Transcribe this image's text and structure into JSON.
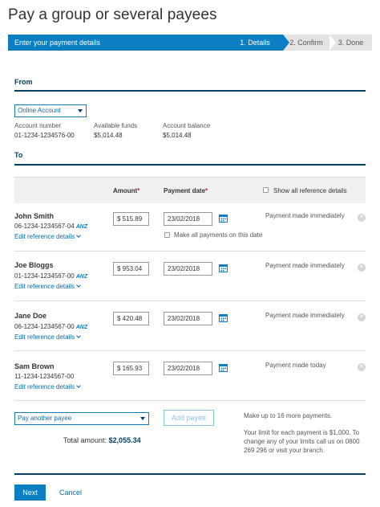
{
  "title": "Pay a group or several payees",
  "progress": {
    "main": "Enter your payment details",
    "steps": [
      "1. Details",
      "2. Confirm",
      "3. Done"
    ]
  },
  "from": {
    "heading": "From",
    "account_select": "Online Account",
    "account_number_label": "Account number",
    "account_number": "01-1234-1234576-00",
    "available_label": "Available funds",
    "available": "$5,014.48",
    "balance_label": "Account balance",
    "balance": "$5,014.48"
  },
  "to": {
    "heading": "To",
    "amount_header": "Amount",
    "date_header": "Payment date",
    "required_mark": "*",
    "show_all_label": "Show all reference details",
    "edit_label": "Edit reference details",
    "make_all_label": "Make all payments on this date",
    "anz_badge": "ANZ",
    "payees": [
      {
        "name": "John Smith",
        "account": "06-1234-1234567-04",
        "anz": true,
        "amount": "$ 515.89",
        "date": "23/02/2018",
        "status": "Payment made immediately"
      },
      {
        "name": "Joe Bloggs",
        "account": "01-1234-1234567-00",
        "anz": true,
        "amount": "$ 953.04",
        "date": "23/02/2018",
        "status": "Payment made immediately"
      },
      {
        "name": "Jane Doe",
        "account": "06-1234-1234567-00",
        "anz": true,
        "amount": "$ 420.48",
        "date": "23/02/2018",
        "status": "Payment made immediately"
      },
      {
        "name": "Sam Brown",
        "account": "11-1234-1234567-00",
        "anz": false,
        "amount": "$ 165.93",
        "date": "23/02/2018",
        "status": "Payment made today"
      }
    ]
  },
  "footer": {
    "another_payee": "Pay another payee",
    "add_payee": "Add payee",
    "limit_info_1": "Make up to 16 more payments.",
    "limit_info_2": "Your limit for each payment is $1,000. To change any of your limits call us on 0800 269 296 or visit your branch.",
    "total_label": "Total amount:",
    "total_value": "$2,055.34",
    "next": "Next",
    "cancel": "Cancel"
  },
  "colors": {
    "brand": "#0b7fc1",
    "navy": "#004165",
    "link": "#0b6aa8",
    "required": "#d3232f"
  }
}
